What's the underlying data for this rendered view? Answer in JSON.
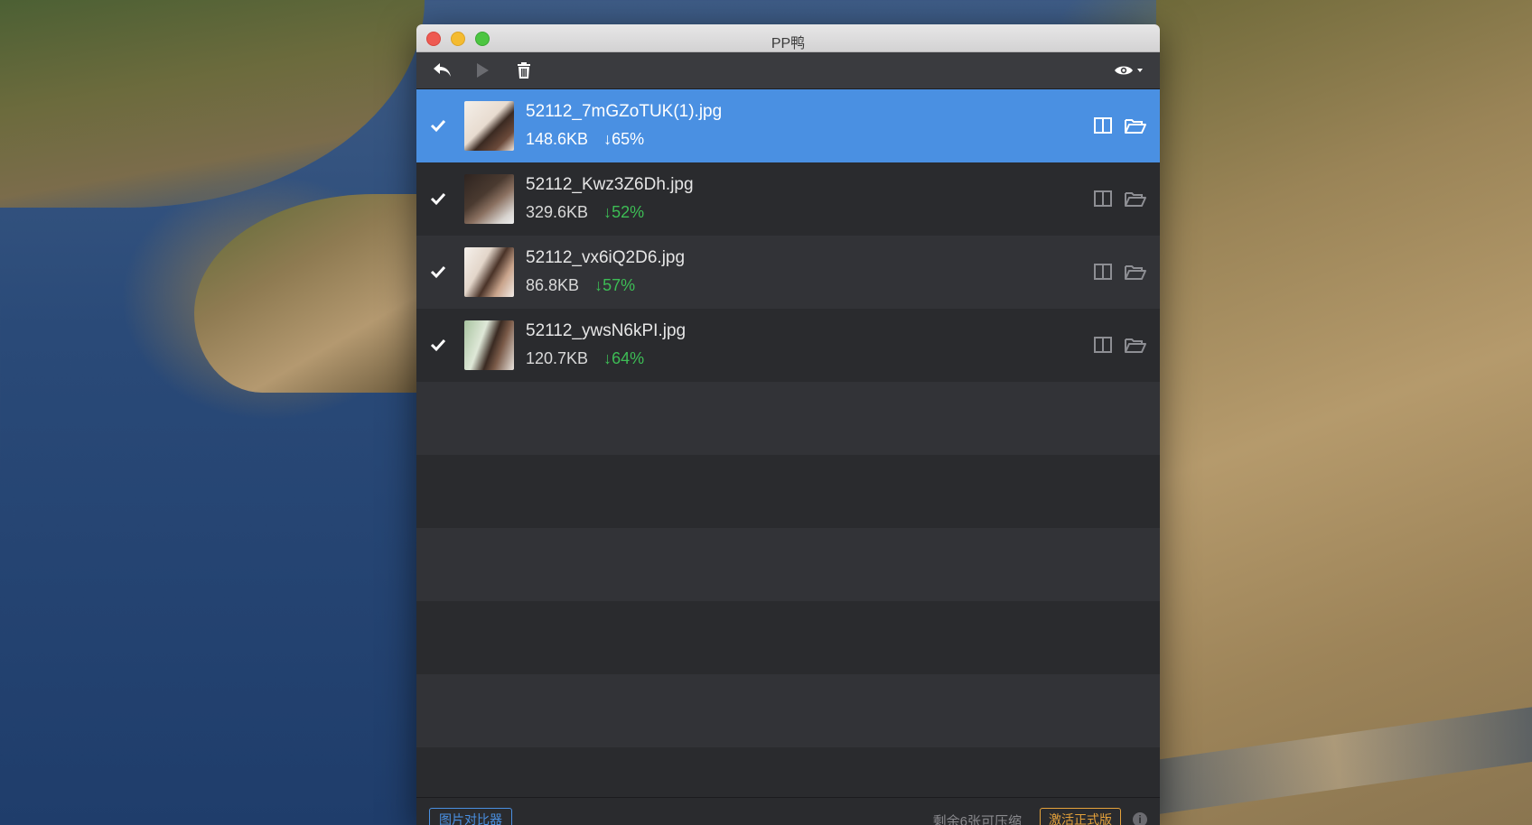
{
  "window": {
    "title": "PP鸭"
  },
  "toolbar": {
    "undo_icon": "undo-icon",
    "play_icon": "play-icon",
    "trash_icon": "trash-icon",
    "view_icon": "eye-icon"
  },
  "files": [
    {
      "name": "52112_7mGZoTUK(1).jpg",
      "size": "148.6KB",
      "saving": "65%",
      "checked": true,
      "selected": true
    },
    {
      "name": "52112_Kwz3Z6Dh.jpg",
      "size": "329.6KB",
      "saving": "52%",
      "checked": true,
      "selected": false
    },
    {
      "name": "52112_vx6iQ2D6.jpg",
      "size": "86.8KB",
      "saving": "57%",
      "checked": true,
      "selected": false
    },
    {
      "name": "52112_ywsN6kPI.jpg",
      "size": "120.7KB",
      "saving": "64%",
      "checked": true,
      "selected": false
    }
  ],
  "footer": {
    "compare_button": "图片对比器",
    "remaining_text": "剩余6张可压缩",
    "activate_button": "激活正式版"
  },
  "colors": {
    "accent": "#4a90e2",
    "saving_green": "#3dbd55",
    "activate_orange": "#e5a23b"
  }
}
